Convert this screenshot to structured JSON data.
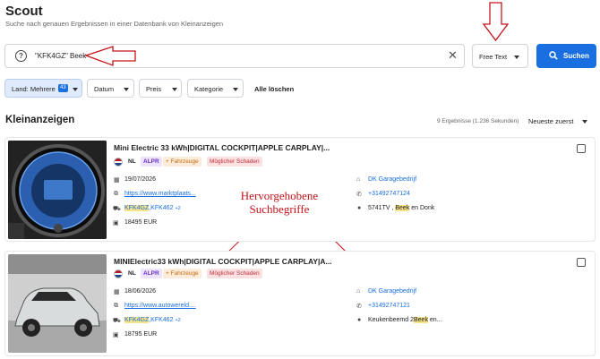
{
  "header": {
    "title": "Scout",
    "subtitle": "Suche nach genauen Ergebnissen in einer Datenbank von Kleinanzeigen"
  },
  "search": {
    "query": "\"KFK4GZ\" Beek",
    "mode": "Free Text",
    "button_label": "Suchen"
  },
  "filters": {
    "land": "Land: Mehrere",
    "land_count": "43",
    "datum": "Datum",
    "preis": "Preis",
    "kategorie": "Kategorie",
    "clear_all": "Alle löschen"
  },
  "results": {
    "section_title": "Kleinanzeigen",
    "count_text": "9 Ergebnisse (1.236 Sekunden)",
    "sort": "Neueste zuerst"
  },
  "annotation": {
    "line1": "Hervorgehobene",
    "line2": "Suchbegriffe"
  },
  "listings": [
    {
      "title": "Mini Electric 33 kWh|DIGITAL COCKPIT|APPLE CARPLAY|...",
      "country": "NL",
      "tag_alpr": "ALPR",
      "tag_vehicles": "+ Fahrzeuge",
      "tag_damage": "Möglicher Schaden",
      "date": "19/07/2026",
      "url": "https://www.marktplaats...",
      "plate_hl": "KFK4GZ",
      "plate_rest": ",KFK462",
      "plate_more": "+2",
      "price": "18495 EUR",
      "dealer": "DK Garagebedrijf",
      "phone": "+31492747124",
      "addr_pre": "5741TV , ",
      "addr_hl": "Beek",
      "addr_post": " en Donk"
    },
    {
      "title": "MINIElectric33 kWh|DIGITAL COCKPIT|APPLE CARPLAY|A...",
      "country": "NL",
      "tag_alpr": "ALPR",
      "tag_vehicles": "+ Fahrzeuge",
      "tag_damage": "Möglicher Schaden",
      "date": "18/06/2026",
      "url": "https://www.autowereld....",
      "plate_hl": "KFK4GZ",
      "plate_rest": ",KFK462",
      "plate_more": "+2",
      "price": "18795 EUR",
      "dealer": "DK Garagebedrijf",
      "phone": "+31492747121",
      "addr_pre": "Keukenbeemd 2",
      "addr_hl": "Beek",
      "addr_post": " en..."
    }
  ],
  "colors": {
    "accent": "#1a6fe0",
    "annotation": "#c4141a",
    "highlight": "#f6e38a"
  }
}
